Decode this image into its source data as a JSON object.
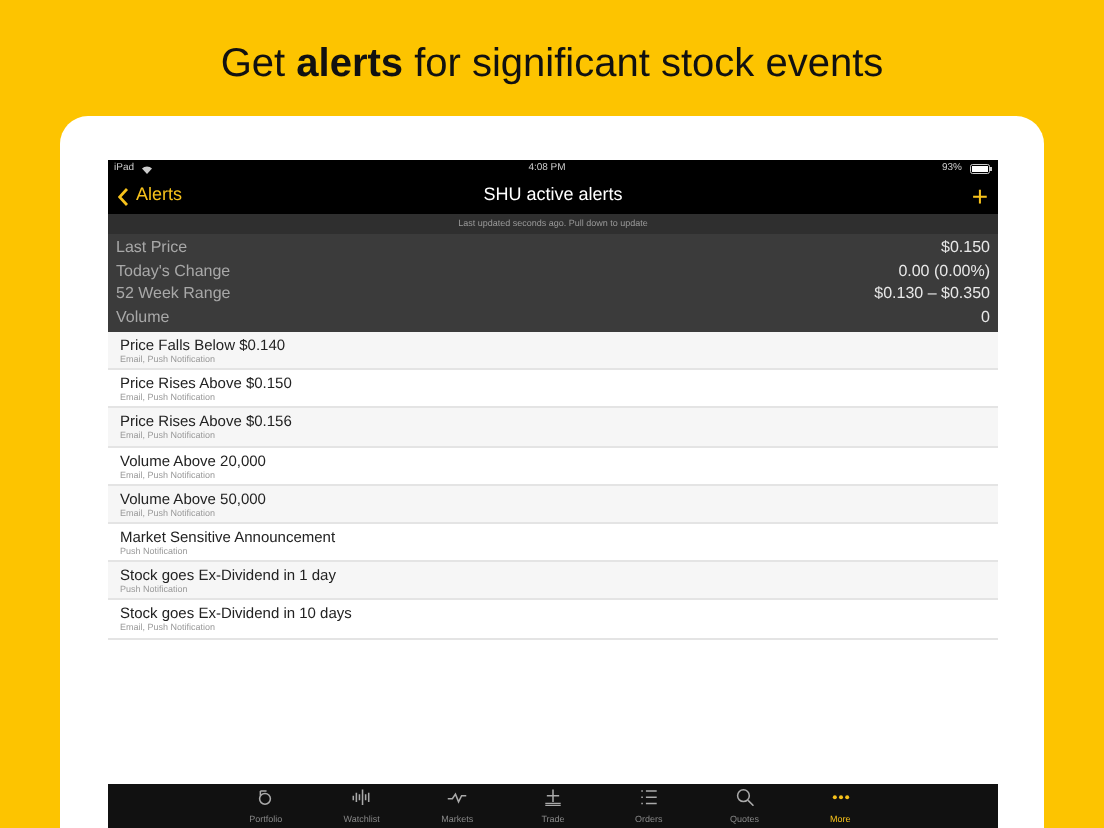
{
  "headline": "Get **alerts** for significant stock events",
  "status_bar": {
    "device": "iPad",
    "time": "4:08 PM",
    "battery": "93%"
  },
  "nav": {
    "back": "Alerts",
    "title": "SHU active alerts",
    "add": "+"
  },
  "update_note": "Last updated seconds ago. Pull down to update",
  "stats": [
    {
      "label": "Last Price",
      "value": "$0.150"
    },
    {
      "label": "Today's Change",
      "value": "0.00 (0.00%)"
    },
    {
      "label": "52 Week Range",
      "value": "$0.130 – $0.350"
    },
    {
      "label": "Volume",
      "value": "0"
    }
  ],
  "alerts": [
    {
      "title": "Price Falls Below $0.140",
      "channels": "Email, Push Notification"
    },
    {
      "title": "Price Rises Above $0.150",
      "channels": "Email, Push Notification"
    },
    {
      "title": "Price Rises Above $0.156",
      "channels": "Email, Push Notification"
    },
    {
      "title": "Volume Above 20,000",
      "channels": "Email, Push Notification"
    },
    {
      "title": "Volume Above 50,000",
      "channels": "Email, Push Notification"
    },
    {
      "title": "Market Sensitive Announcement",
      "channels": "Push Notification"
    },
    {
      "title": "Stock goes Ex-Dividend in 1 day",
      "channels": "Push Notification"
    },
    {
      "title": "Stock goes Ex-Dividend in 10 days",
      "channels": "Email, Push Notification"
    }
  ],
  "tabs": [
    {
      "label": "Portfolio",
      "kind": "portfolio",
      "selected": false
    },
    {
      "label": "Watchlist",
      "kind": "watchlist",
      "selected": false
    },
    {
      "label": "Markets",
      "kind": "markets",
      "selected": false
    },
    {
      "label": "Trade",
      "kind": "trade",
      "selected": false
    },
    {
      "label": "Orders",
      "kind": "orders",
      "selected": false
    },
    {
      "label": "Quotes",
      "kind": "quotes",
      "selected": false
    },
    {
      "label": "More",
      "kind": "more",
      "selected": true
    }
  ]
}
